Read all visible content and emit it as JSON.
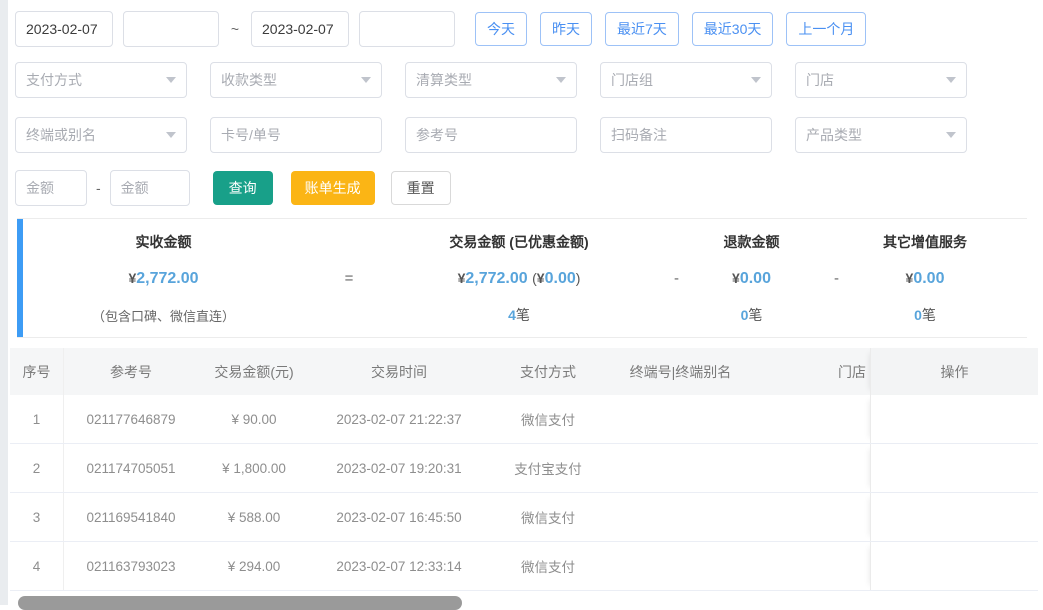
{
  "filters": {
    "date_start": "2023-02-07",
    "time_start": "",
    "date_end": "2023-02-07",
    "time_end": "",
    "range_separator": "~",
    "quick_buttons": [
      "今天",
      "昨天",
      "最近7天",
      "最近30天",
      "上一个月"
    ],
    "select_placeholders": [
      "支付方式",
      "收款类型",
      "清算类型",
      "门店组",
      "门店"
    ],
    "terminal_select_placeholder": "终端或别名",
    "card_no_placeholder": "卡号/单号",
    "ref_no_placeholder": "参考号",
    "scan_remark_placeholder": "扫码备注",
    "product_type_placeholder": "产品类型",
    "amount_min_placeholder": "金额",
    "amount_max_placeholder": "金额",
    "amount_separator": "-",
    "search_label": "查询",
    "bill_generate_label": "账单生成",
    "reset_label": "重置"
  },
  "summary": {
    "currency": "¥",
    "count_suffix": "笔",
    "separators": [
      "=",
      "-",
      "-"
    ],
    "columns": [
      {
        "label": "实收金额",
        "amount": "2,772.00",
        "note": "（包含口碑、微信直连）"
      },
      {
        "label": "交易金额 (已优惠金额)",
        "amount": "2,772.00",
        "discount_amount": "0.00",
        "count": "4"
      },
      {
        "label": "退款金额",
        "amount": "0.00",
        "count": "0"
      },
      {
        "label": "其它增值服务",
        "amount": "0.00",
        "count": "0"
      }
    ]
  },
  "table": {
    "headers": {
      "seq": "序号",
      "ref": "参考号",
      "amount": "交易金额(元)",
      "time": "交易时间",
      "pay_method": "支付方式",
      "terminal": "终端号|终端别名",
      "store": "门店",
      "action": "操作"
    },
    "rows": [
      {
        "seq": "1",
        "ref": "021177646879",
        "amount": "¥ 90.00",
        "time": "2023-02-07 21:22:37",
        "pay_method": "微信支付",
        "terminal": "",
        "store": "",
        "action": ""
      },
      {
        "seq": "2",
        "ref": "021174705051",
        "amount": "¥ 1,800.00",
        "time": "2023-02-07 19:20:31",
        "pay_method": "支付宝支付",
        "terminal": "",
        "store": "",
        "action": ""
      },
      {
        "seq": "3",
        "ref": "021169541840",
        "amount": "¥ 588.00",
        "time": "2023-02-07 16:45:50",
        "pay_method": "微信支付",
        "terminal": "",
        "store": "",
        "action": ""
      },
      {
        "seq": "4",
        "ref": "021163793023",
        "amount": "¥ 294.00",
        "time": "2023-02-07 12:33:14",
        "pay_method": "微信支付",
        "terminal": "",
        "store": "",
        "action": ""
      }
    ]
  },
  "colors": {
    "accent_blue": "#4a90f2",
    "amount_blue": "#58a4db",
    "summary_bar_blue": "#3d9cf5",
    "search_teal": "#18a089",
    "bill_amber": "#fbb515",
    "header_bg": "#f5f6f7"
  }
}
